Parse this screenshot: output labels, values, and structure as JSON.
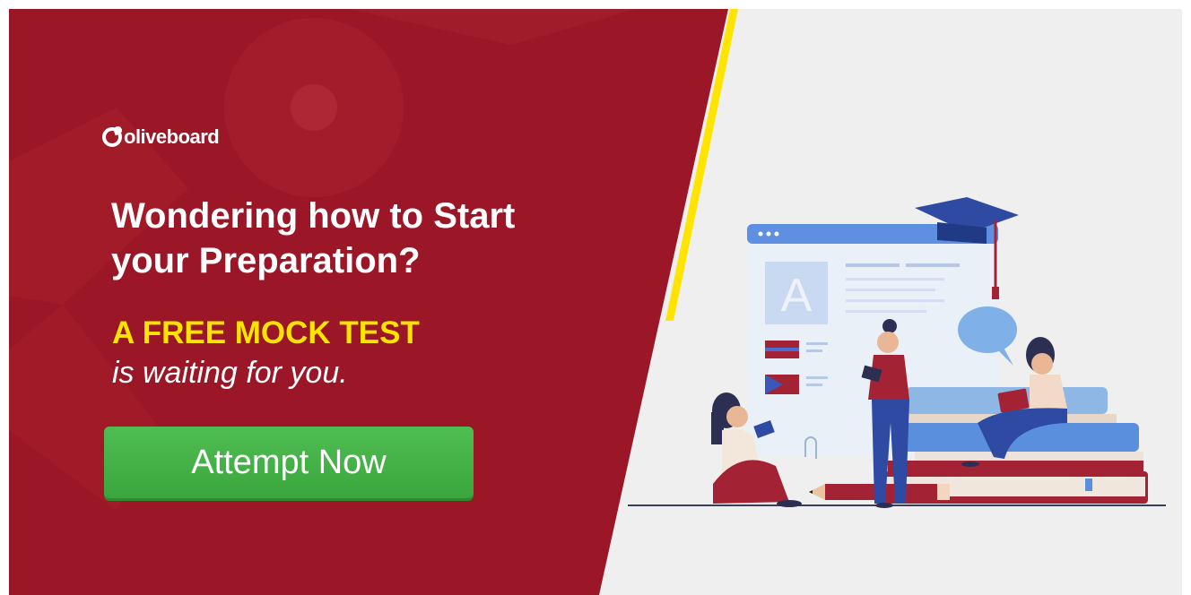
{
  "logo": {
    "text": "oliveboard"
  },
  "headline": {
    "line1": "Wondering how to Start",
    "line2": "your Preparation?"
  },
  "offer": {
    "text": "A FREE MOCK TEST"
  },
  "subline": {
    "text": "is waiting for you."
  },
  "cta": {
    "label": "Attempt Now"
  },
  "illustration": {
    "card_letter": "A"
  },
  "colors": {
    "red": "#9b1626",
    "accent_yellow": "#ffe400",
    "cta_green": "#43b346",
    "background": "#efefef"
  }
}
